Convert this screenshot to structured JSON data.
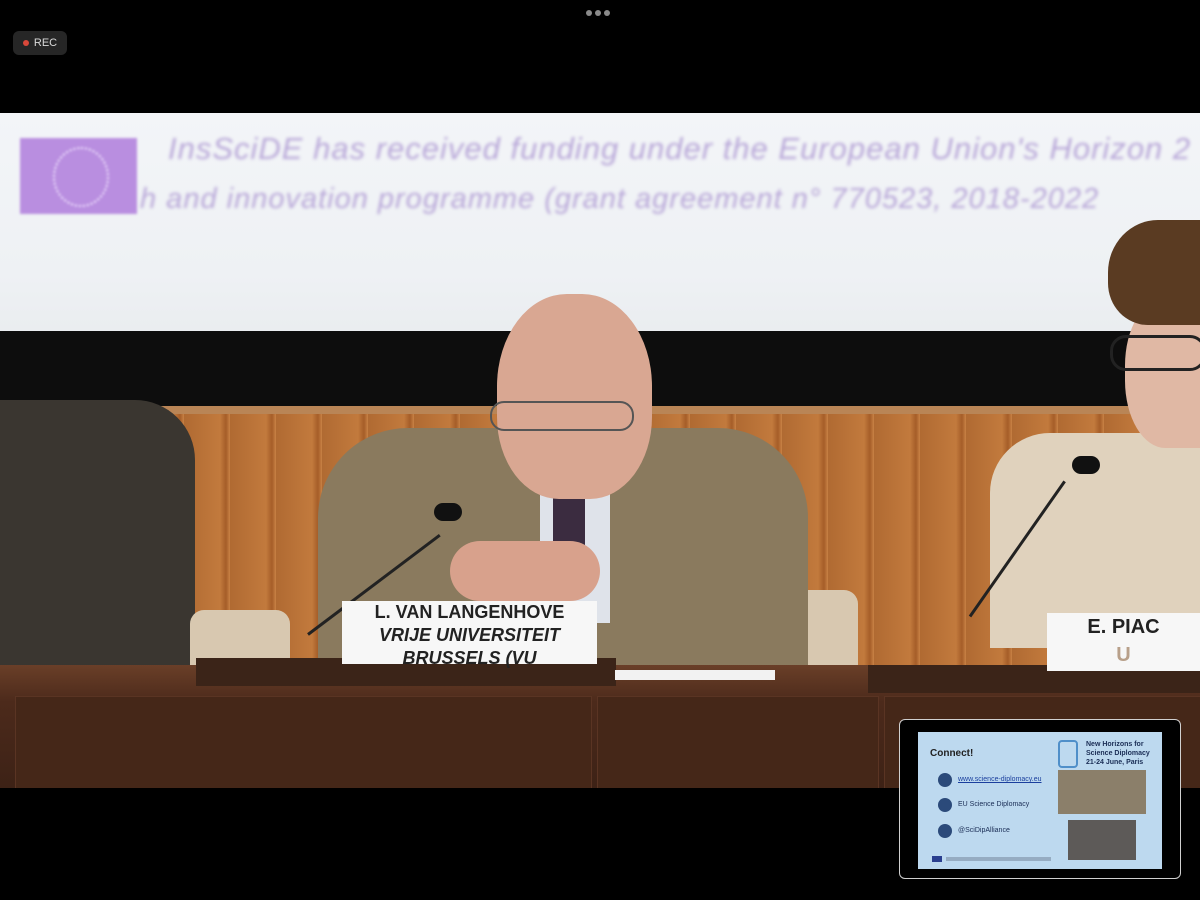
{
  "header": {
    "menu_icon": "more-horizontal-icon",
    "rec_label": "REC"
  },
  "video": {
    "banner_line1": "InsSciDE has received funding under the European Union's Horizon 2",
    "banner_line2": "h and innovation programme (grant agreement n° 770523, 2018-2022",
    "namecards": {
      "center_line1": "L. VAN LANGENHOVE",
      "center_line2": "VRIJE UNIVERSITEIT",
      "center_line3": "BRUSSELS (VU",
      "right_line1": "E. PIAC",
      "right_line2": "U"
    }
  },
  "pip": {
    "connect": "Connect!",
    "title_line1": "New Horizons for",
    "title_line2": "Science Diplomacy",
    "title_line3": "21-24 June, Paris",
    "link_web": "www.science-diplomacy.eu",
    "link_linkedin": "EU Science Diplomacy",
    "link_twitter": "@SciDipAlliance"
  },
  "colors": {
    "rec_dot": "#d9483a",
    "eu_flag": "#b98ee0",
    "banner_text": "#b8a7d8"
  }
}
